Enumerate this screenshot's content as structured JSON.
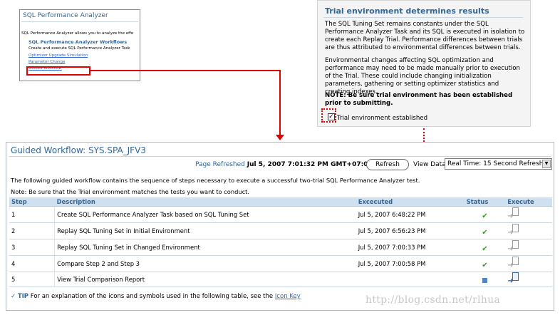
{
  "thumbnail": {
    "title": "SQL Performance Analyzer",
    "description": "SQL Performance Analyzer allows you to analyze the effe",
    "workflows_heading": "SQL Performance Analyzer Workflows",
    "create_text": "Create and execute SQL Performance Analyzer Task",
    "links": [
      "Optimizer Upgrade Simulation",
      "Parameter Change",
      "Guided Workflow"
    ]
  },
  "trial_panel": {
    "title": "Trial environment determines results",
    "para1": "The SQL Tuning Set remains constants under the SQL Performance Analyzer Task and its SQL is executed in isolation to create each Replay Trial. Performance differences between trials are thus attributed to environmental differences between trials.",
    "para2": "Environmental changes affecting SQL optimization and performance may need to be made manually prior to execution of the Trial. These could include changing initialization parameters, gathering or setting optimizer statistics and creating indexes.",
    "note": "NOTE: Be sure trial environment has been established prior to submitting.",
    "checkbox_mark": "✓",
    "checkbox_label": "Trial environment established",
    "checkbox_checked": true
  },
  "workflow": {
    "title": "Guided Workflow: SYS.SPA_JFV3",
    "page_refreshed_label": "Page Refreshed",
    "page_refreshed_value": "Jul 5, 2007 7:01:32 PM GMT+07:00",
    "refresh_button": "Refresh",
    "view_data_label": "View Data",
    "view_data_value": "Real Time: 15 Second Refresh",
    "intro": "The following guided workflow contains the sequence of steps necessary to execute a successful two-trial SQL Performance Analyzer test.",
    "note": "Note: Be sure that the Trial environment matches the tests you want to conduct.",
    "columns": [
      "Step",
      "Description",
      "Excecuted",
      "Status",
      "Execute"
    ],
    "rows": [
      {
        "step": "1",
        "description": "Create SQL Performance Analyzer Task based on SQL Tuning Set",
        "executed": "Jul 5, 2007 6:48:22 PM",
        "status": "complete"
      },
      {
        "step": "2",
        "description": "Replay SQL Tuning Set in Initial Environment",
        "executed": "Jul 5, 2007 6:56:23 PM",
        "status": "complete"
      },
      {
        "step": "3",
        "description": "Replay SQL Tuning Set in Changed Environment",
        "executed": "Jul 5, 2007 7:00:33 PM",
        "status": "complete"
      },
      {
        "step": "4",
        "description": "Compare Step 2 and Step 3",
        "executed": "Jul 5, 2007 7:00:58 PM",
        "status": "complete"
      },
      {
        "step": "5",
        "description": "View Trial Comparison Report",
        "executed": "",
        "status": "pending"
      }
    ],
    "tip_label": "TIP",
    "tip_text": "For an explanation of the icons and symbols used in the following table, see the",
    "tip_link": "Icon Key"
  },
  "icons": {
    "status_complete": "✔",
    "status_pending": "square",
    "execute": "execute-arrow"
  },
  "watermark": "http://blog.csdn.net/rlhua",
  "colors": {
    "heading": "#336699",
    "highlight": "#e00000",
    "table_header": "#cfe0f1",
    "check": "#3a9a2a"
  }
}
